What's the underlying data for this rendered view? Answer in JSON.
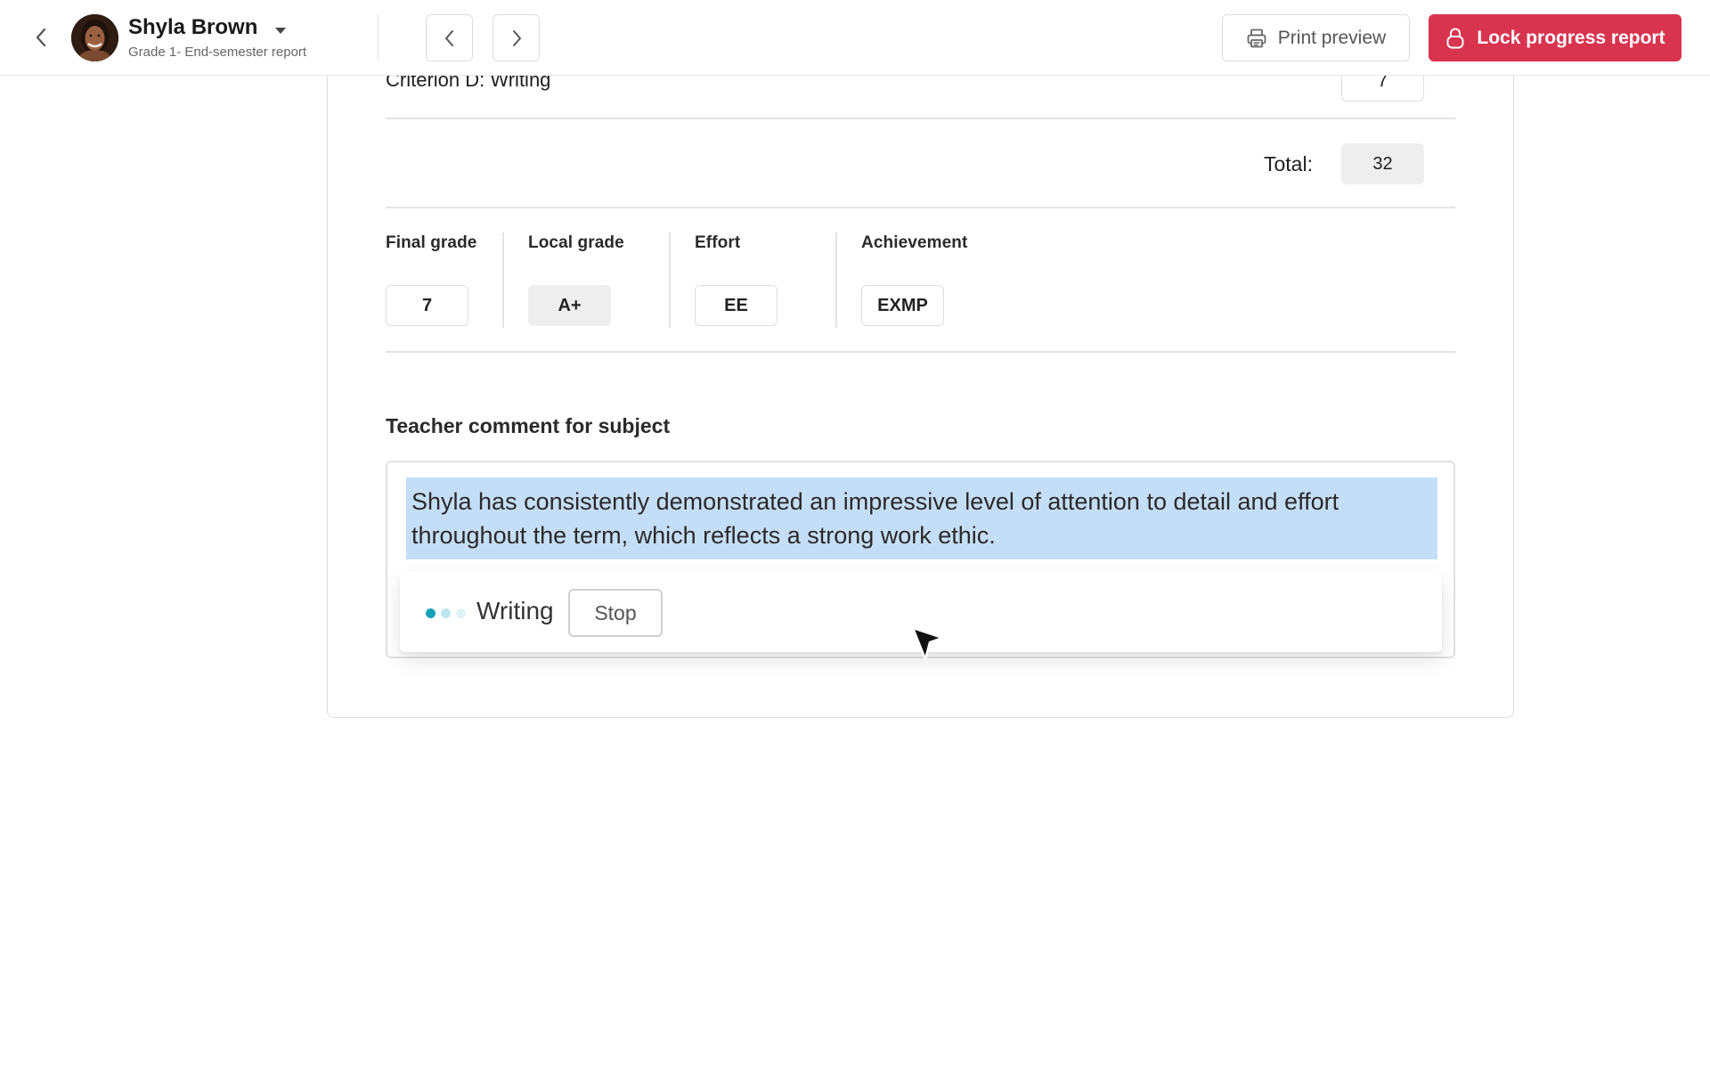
{
  "header": {
    "student_name": "Shyla Brown",
    "report_subtitle": "Grade 1- End-semester report",
    "print_label": "Print preview",
    "lock_label": "Lock progress report",
    "icons": {
      "back": "chevron-left-icon",
      "dropdown": "caret-down-icon",
      "prev": "chevron-left-icon",
      "next": "chevron-right-icon",
      "print": "printer-icon",
      "lock": "lock-icon"
    },
    "accent_color": "#d9344f"
  },
  "criteria": {
    "label": "Criterion D: Writing",
    "score": "7"
  },
  "total": {
    "label": "Total:",
    "value": "32"
  },
  "grades": [
    {
      "label": "Final grade",
      "value": "7"
    },
    {
      "label": "Local grade",
      "value": "A+"
    },
    {
      "label": "Effort",
      "value": "EE"
    },
    {
      "label": "Achievement",
      "value": "EXMP"
    }
  ],
  "comment": {
    "title": "Teacher comment for subject",
    "text": "Shyla has consistently demonstrated an impressive level of attention to detail and effort throughout the term, which reflects a strong work ethic.",
    "highlight_color": "#c5def7"
  },
  "writing": {
    "status": "Writing",
    "stop_label": "Stop",
    "dot_colors": [
      "#1aa3b8",
      "#bde6ee",
      "#dff2f6"
    ]
  }
}
